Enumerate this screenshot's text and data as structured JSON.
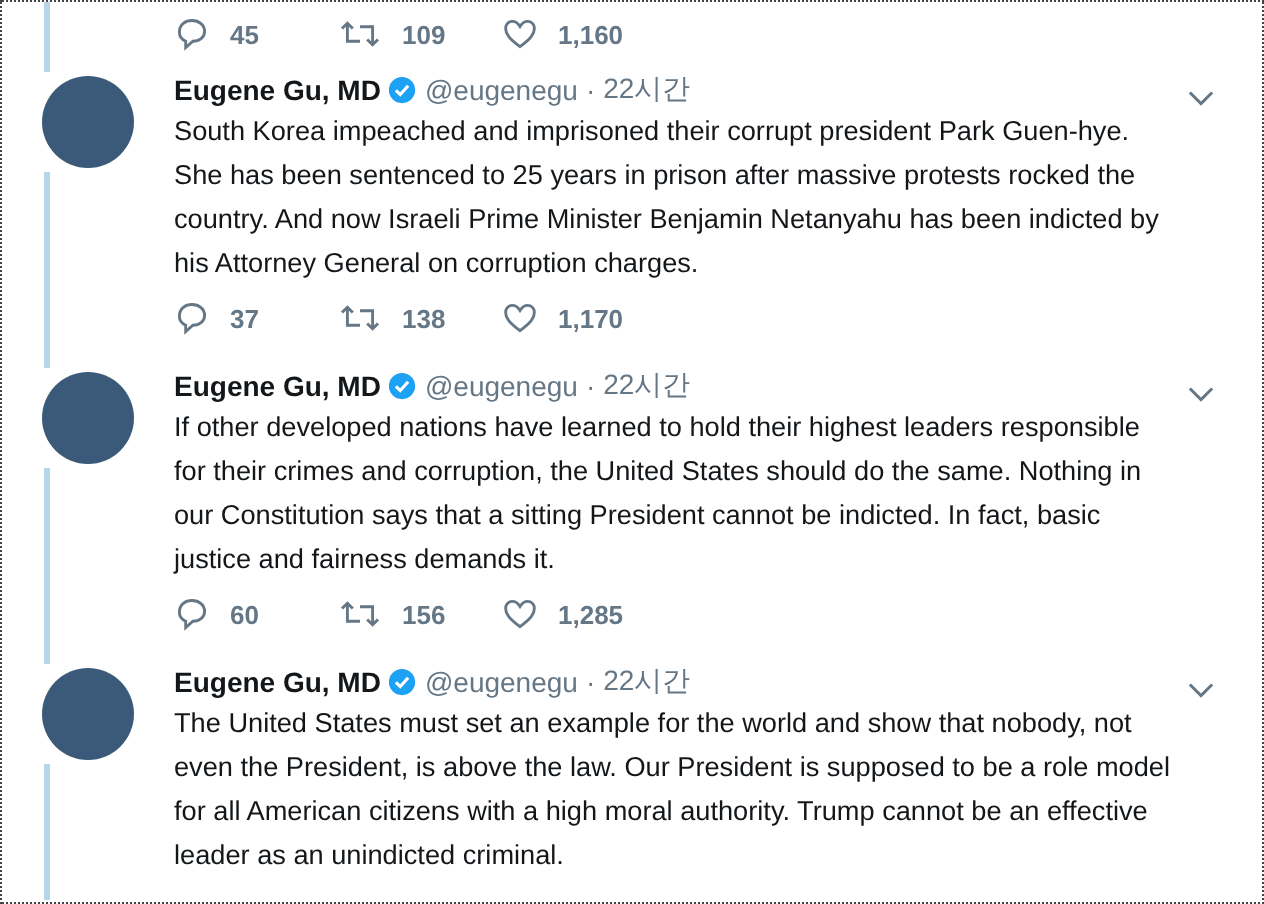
{
  "top_actions": {
    "replies": "45",
    "retweets": "109",
    "likes": "1,160"
  },
  "tweets": [
    {
      "name": "Eugene Gu, MD",
      "verified": true,
      "handle": "@eugenegu",
      "separator": "·",
      "time": "22시간",
      "text": "South Korea impeached and imprisoned their corrupt president Park Guen-hye. She has been sentenced to 25 years in prison after massive protests rocked the country. And now Israeli Prime Minister Benjamin Netanyahu has been indicted by his Attorney General on corruption charges.",
      "replies": "37",
      "retweets": "138",
      "likes": "1,170"
    },
    {
      "name": "Eugene Gu, MD",
      "verified": true,
      "handle": "@eugenegu",
      "separator": "·",
      "time": "22시간",
      "text": "If other developed nations have learned to hold their highest leaders responsible for their crimes and corruption, the United States should do the same. Nothing in our Constitution says that a sitting President cannot be indicted. In fact, basic justice and fairness demands it.",
      "replies": "60",
      "retweets": "156",
      "likes": "1,285"
    },
    {
      "name": "Eugene Gu, MD",
      "verified": true,
      "handle": "@eugenegu",
      "separator": "·",
      "time": "22시간",
      "text": "The United States must set an example for the world and show that nobody, not even the President, is above the law. Our President is supposed to be a role model for all American citizens with a high moral authority. Trump cannot be an effective leader as an unindicted criminal."
    }
  ]
}
